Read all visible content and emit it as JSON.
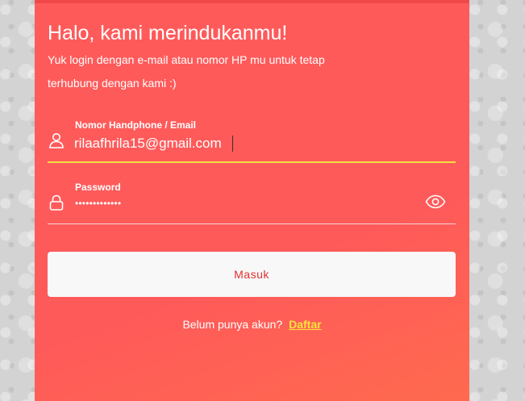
{
  "heading": "Halo, kami merindukanmu!",
  "subheading": "Yuk login dengan e-mail atau nomor HP mu untuk tetap terhubung dengan kami :)",
  "email_field": {
    "label": "Nomor Handphone / Email",
    "value": "rilaafhrila15@gmail.com",
    "icon": "user-icon"
  },
  "password_field": {
    "label": "Password",
    "masked_value": "•••••••••••••",
    "icon": "lock-icon",
    "toggle_icon": "eye-icon"
  },
  "submit_label": "Masuk",
  "signup": {
    "prompt": "Belum punya akun?",
    "link_label": "Daftar"
  },
  "colors": {
    "panel": "#ff5a5a",
    "accent": "#f8e43a",
    "button_text": "#e03030"
  }
}
